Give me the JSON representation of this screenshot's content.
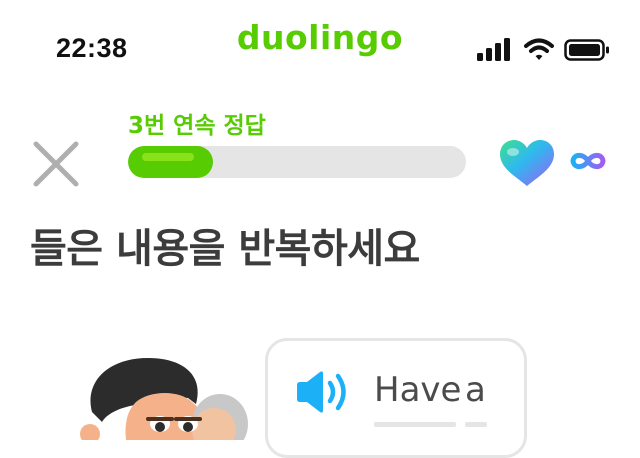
{
  "status_bar": {
    "time": "22:38",
    "icons": [
      "cellular-signal-icon",
      "wifi-icon",
      "battery-icon"
    ]
  },
  "app": {
    "logo_text": "duolingo",
    "brand_color": "#58cc02"
  },
  "lesson": {
    "streak_label": "3번 연속 정답",
    "progress_fraction": 0.25,
    "hearts": "infinite",
    "instruction": "들은 내용을 반복하세요"
  },
  "exercise": {
    "speaker_icon": "speaker-icon",
    "prompt_words": [
      "Have",
      "a"
    ]
  },
  "colors": {
    "progress_track": "#e5e5e5",
    "progress_fill": "#58cc02",
    "speaker": "#1cb0f6",
    "border": "#e5e5e5"
  }
}
